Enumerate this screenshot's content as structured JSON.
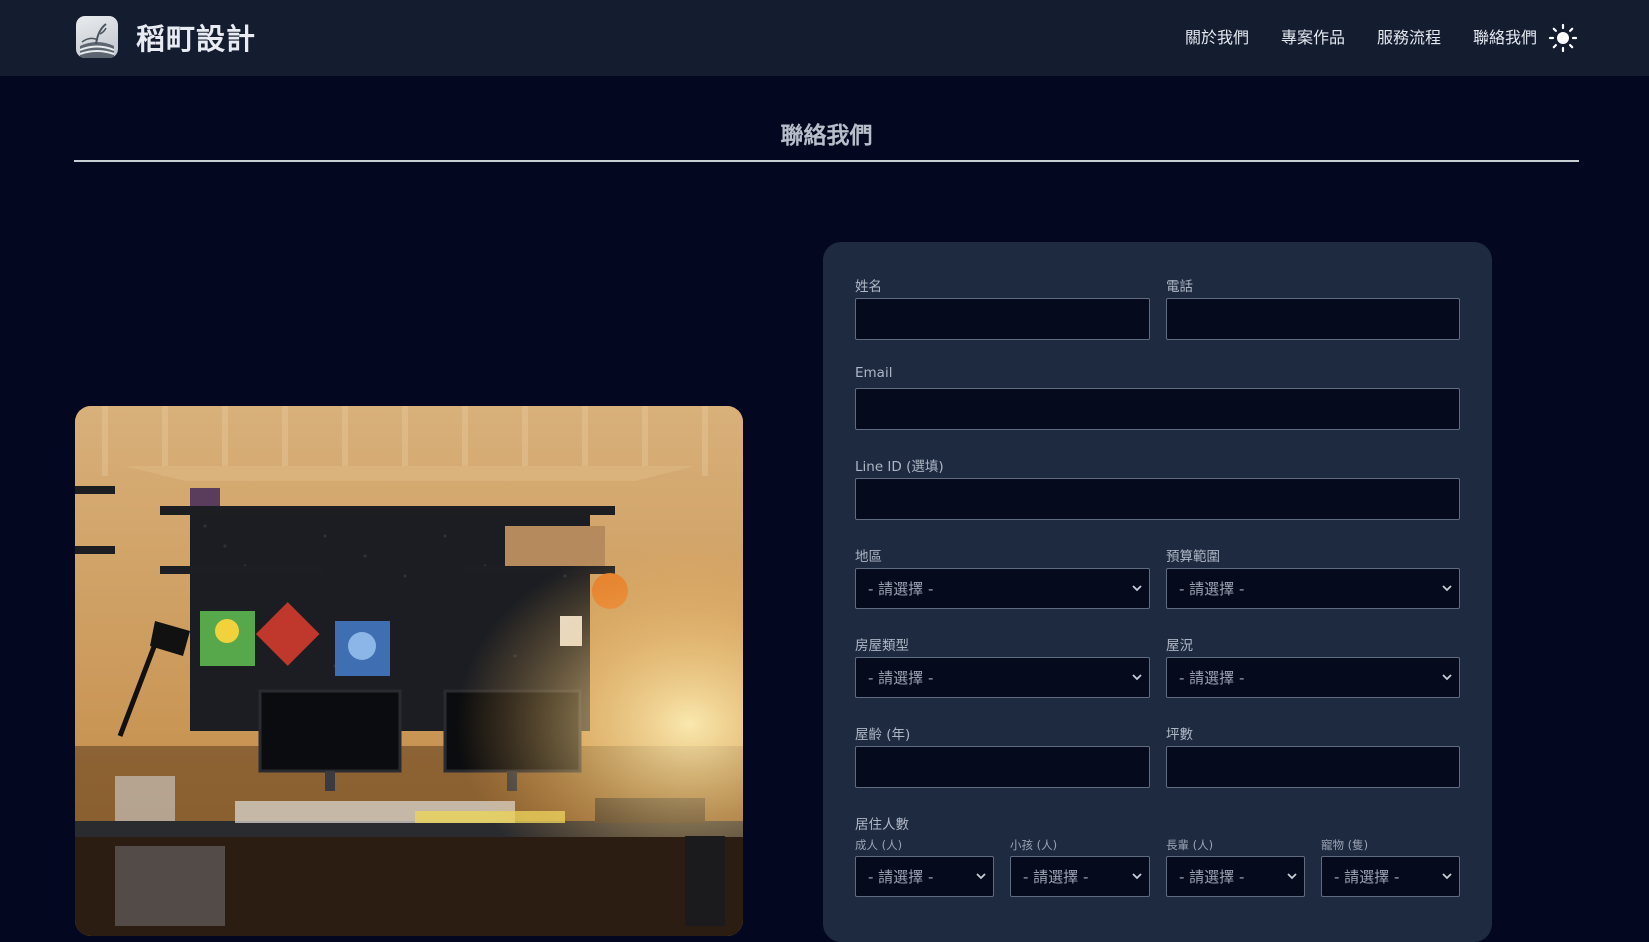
{
  "header": {
    "brand_name": "稻町設計",
    "nav": [
      "關於我們",
      "專案作品",
      "服務流程",
      "聯絡我們"
    ]
  },
  "page": {
    "title": "聯絡我們"
  },
  "form": {
    "name_label": "姓名",
    "phone_label": "電話",
    "email_label": "Email",
    "line_label": "Line ID (選填)",
    "region_label": "地區",
    "budget_label": "預算範圍",
    "house_type_label": "房屋類型",
    "condition_label": "屋況",
    "age_label": "屋齡 (年)",
    "area_label": "坪數",
    "residents_label": "居住人數",
    "adults_label": "成人 (人)",
    "children_label": "小孩 (人)",
    "elders_label": "長輩 (人)",
    "pets_label": "寵物 (隻)",
    "select_placeholder": "- 請選擇 -"
  },
  "colors": {
    "page_bg": "#030720",
    "header_bg": "#141c2f",
    "card_bg": "#1d2a40"
  }
}
